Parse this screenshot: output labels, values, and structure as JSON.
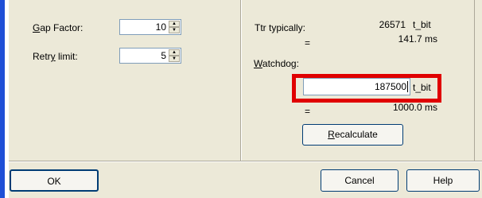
{
  "left": {
    "gap_factor": {
      "label_first": "G",
      "label_rest": "ap Factor:",
      "value": "10"
    },
    "retry_limit": {
      "label_pre": "Retr",
      "label_ul": "y",
      "label_rest": " limit:",
      "value": "5"
    }
  },
  "right": {
    "ttr_label": "Ttr typically:",
    "ttr_value": "26571",
    "ttr_unit": "t_bit",
    "ttr_eq": "=",
    "ttr_ms": "141.7 ms",
    "watchdog_label_first": "W",
    "watchdog_label_rest": "atchdog:",
    "watchdog_value": "187500",
    "watchdog_unit": "t_bit",
    "watchdog_eq": "=",
    "watchdog_ms": "1000.0 ms",
    "recalc_first": "R",
    "recalc_rest": "ecalculate"
  },
  "buttons": {
    "ok": "OK",
    "cancel": "Cancel",
    "help": "Help"
  },
  "colors": {
    "highlight": "#e00000",
    "edge": "#1f4fd6",
    "panel": "#ece9d8"
  }
}
